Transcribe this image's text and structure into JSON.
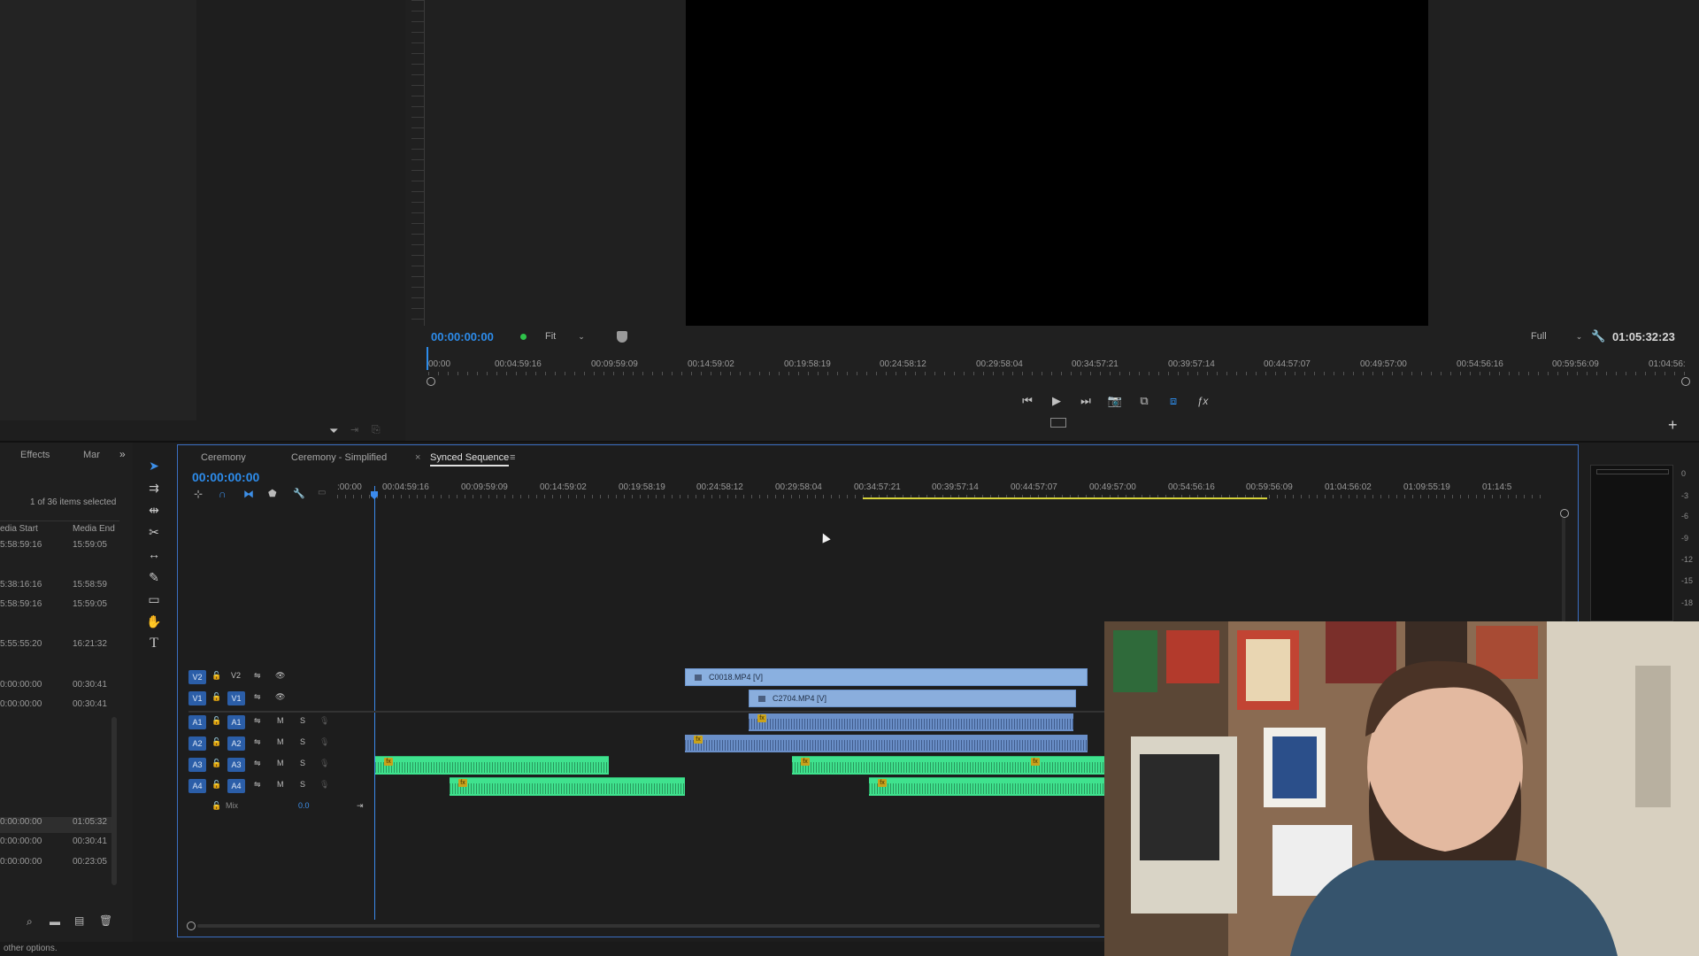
{
  "monitor": {
    "timecode": "00:00:00:00",
    "fit": "Fit",
    "quality": "Full",
    "duration": "01:05:32:23",
    "ruler": [
      "00:00",
      "00:04:59:16",
      "00:09:59:09",
      "00:14:59:02",
      "00:19:58:19",
      "00:24:58:12",
      "00:29:58:04",
      "00:34:57:21",
      "00:39:57:14",
      "00:44:57:07",
      "00:49:57:00",
      "00:54:56:16",
      "00:59:56:09",
      "01:04:56:"
    ]
  },
  "project": {
    "tabs": [
      "Effects",
      "Mar"
    ],
    "selection": "1 of 36 items selected",
    "columns": [
      "edia Start",
      "Media End"
    ],
    "rows": [
      [
        "5:58:59:16",
        "15:59:05"
      ],
      [
        "5:38:16:16",
        "15:58:59"
      ],
      [
        "5:58:59:16",
        "15:59:05"
      ],
      [
        "5:55:55:20",
        "16:21:32"
      ],
      [
        "0:00:00:00",
        "00:30:41"
      ],
      [
        "0:00:00:00",
        "00:30:41"
      ],
      [
        "0:00:00:00",
        "01:05:32"
      ],
      [
        "0:00:00:00",
        "00:30:41"
      ],
      [
        "0:00:00:00",
        "00:23:05"
      ]
    ]
  },
  "timeline": {
    "tabs": [
      "Ceremony",
      "Ceremony - Simplified",
      "Synced Sequence"
    ],
    "close_glyph": "×",
    "menu_glyph": "≡",
    "timecode": "00:00:00:00",
    "ruler": [
      ":00:00",
      "00:04:59:16",
      "00:09:59:09",
      "00:14:59:02",
      "00:19:58:19",
      "00:24:58:12",
      "00:29:58:04",
      "00:34:57:21",
      "00:39:57:14",
      "00:44:57:07",
      "00:49:57:00",
      "00:54:56:16",
      "00:59:56:09",
      "01:04:56:02",
      "01:09:55:19",
      "01:14:5"
    ],
    "tracks": {
      "v2": {
        "src": "V2",
        "name": "V2"
      },
      "v1": {
        "src": "V1",
        "name": "V1"
      },
      "a1": {
        "src": "A1",
        "name": "A1"
      },
      "a2": {
        "src": "A2",
        "name": "A2"
      },
      "a3": {
        "src": "A3",
        "name": "A3"
      },
      "a4": {
        "src": "A4",
        "name": "A4"
      }
    },
    "mute": "M",
    "solo": "S",
    "mix_label": "Mix",
    "mix_value": "0.0",
    "clips": {
      "v2_clip": "C0018.MP4 [V]",
      "v1_clip": "C2704.MP4 [V]"
    },
    "fx_glyph": "fx"
  },
  "meter_scale": [
    "0",
    "-3",
    "-6",
    "-9",
    "-12",
    "-15",
    "-18"
  ],
  "status": {
    "text": "other options."
  },
  "colors": {
    "accent": "#2d8ceb",
    "audio_clip": "#3fe28e",
    "video_clip": "#8ab0e0",
    "track_button": "#2b5ea8"
  }
}
